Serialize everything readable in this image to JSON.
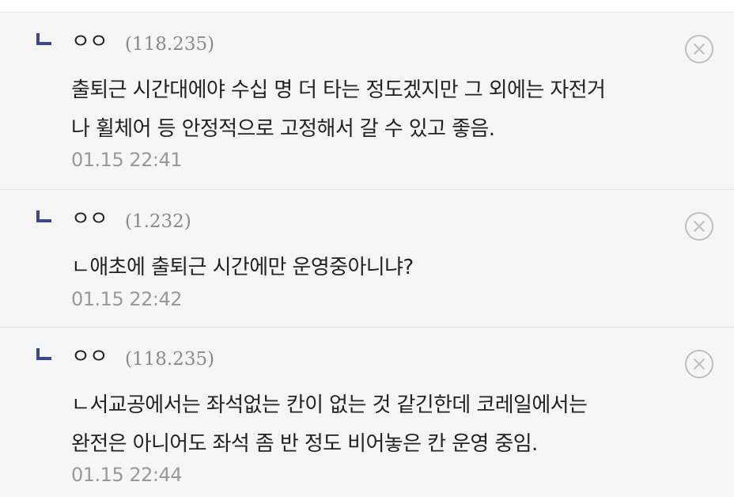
{
  "replies": [
    {
      "nickname": "ㅇㅇ",
      "ip": "(118.235)",
      "text": "출퇴근 시간대에야 수십 명 더 타는 정도겠지만 그 외에는 자전거\n나 휠체어 등 안정적으로 고정해서 갈 수 있고 좋음.",
      "time": "01.15 22:41",
      "delete_icon": "close-circle-icon"
    },
    {
      "nickname": "ㅇㅇ",
      "ip": "(1.232)",
      "text": "ㄴ애초에 출퇴근 시간에만 운영중아니냐?",
      "time": "01.15 22:42",
      "delete_icon": "close-circle-icon"
    },
    {
      "nickname": "ㅇㅇ",
      "ip": "(118.235)",
      "text": "ㄴ서교공에서는 좌석없는 칸이 없는 것 같긴한데 코레일에서는\n완전은 아니어도 좌석 좀 반 정도 비어놓은 칸 운영 중임.",
      "time": "01.15 22:44",
      "delete_icon": "close-circle-icon"
    }
  ],
  "colors": {
    "reply_marker": "#3b4890",
    "reply_bg": "#f6f6f6",
    "meta_text": "#999999"
  }
}
